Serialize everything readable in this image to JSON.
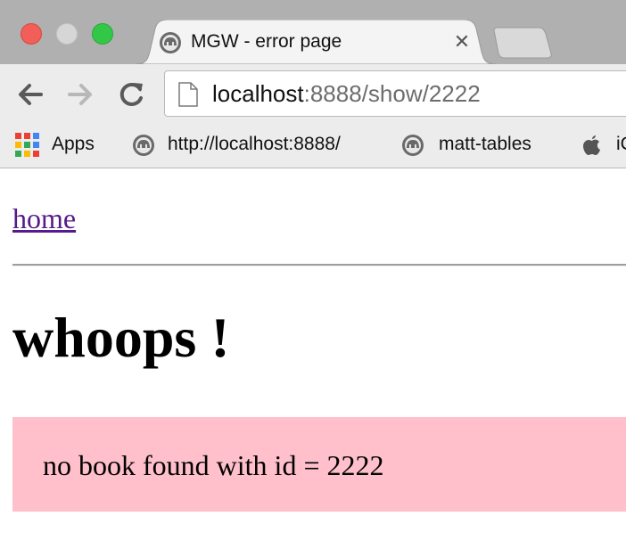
{
  "window": {
    "tab": {
      "title": "MGW - error page",
      "favicon": "elephant-icon",
      "close_glyph": "✕"
    }
  },
  "toolbar": {
    "url_host": "localhost",
    "url_path": ":8888/show/2222"
  },
  "bookmarks": {
    "items": [
      {
        "label": "Apps",
        "icon": "apps-grid-icon"
      },
      {
        "label": "http://localhost:8888/",
        "icon": "elephant-icon"
      },
      {
        "label": "matt-tables",
        "icon": "elephant-icon"
      },
      {
        "label": "iC",
        "icon": "apple-icon"
      }
    ]
  },
  "page": {
    "home_link": "home",
    "heading": "whoops !",
    "error_message": "no book found with id = 2222",
    "colors": {
      "error_background": "#ffc0cb",
      "visited_link": "#551a8b"
    }
  }
}
